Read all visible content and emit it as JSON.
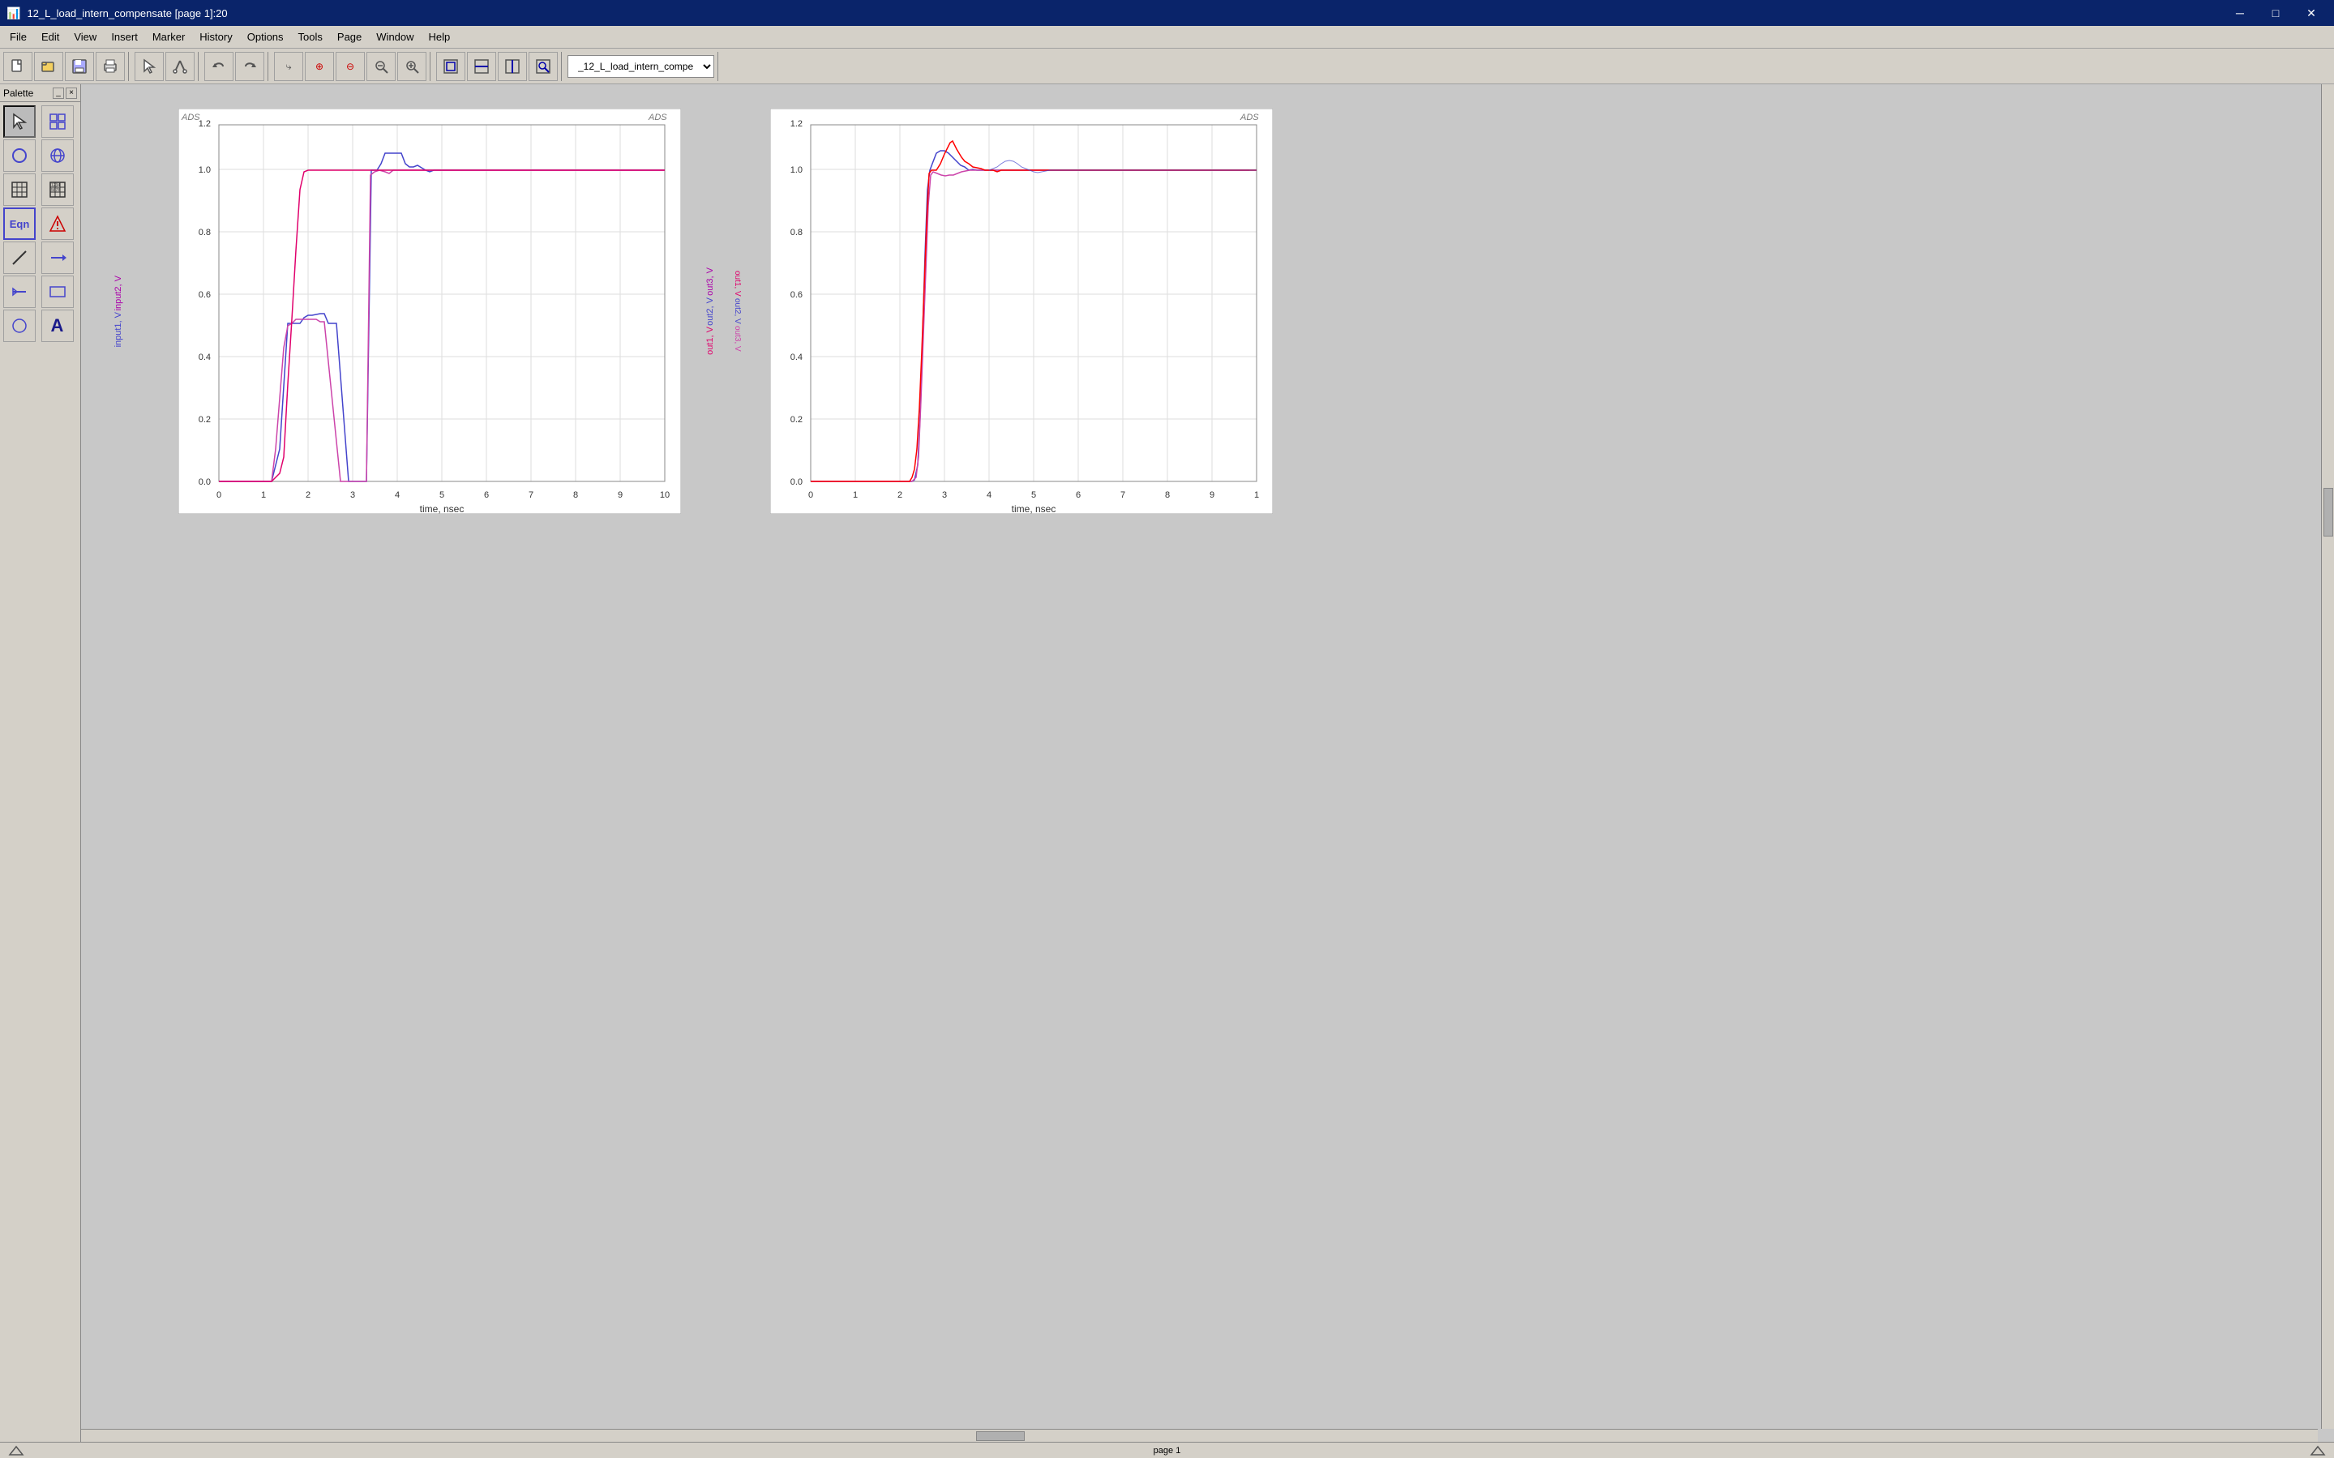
{
  "titleBar": {
    "title": "12_L_load_intern_compensate [page 1]:20",
    "minimize": "─",
    "maximize": "□",
    "close": "✕"
  },
  "menuBar": {
    "items": [
      "File",
      "Edit",
      "View",
      "Insert",
      "Marker",
      "History",
      "Options",
      "Tools",
      "Page",
      "Window",
      "Help"
    ]
  },
  "toolbar": {
    "dropdown": "_12_L_load_intern_compe ▾",
    "buttons": [
      "new",
      "open",
      "save",
      "print",
      "pointer",
      "cut",
      "undo",
      "redo",
      "probe",
      "add-marker",
      "zoom-in",
      "zoom-out",
      "zoom-fit",
      "zoom-area"
    ]
  },
  "palette": {
    "title": "Palette",
    "tools": [
      {
        "name": "pointer",
        "icon": "↖"
      },
      {
        "name": "grid",
        "icon": "⊞"
      },
      {
        "name": "circle-outline",
        "icon": "◯"
      },
      {
        "name": "globe",
        "icon": "🌐"
      },
      {
        "name": "table-small",
        "icon": "▦"
      },
      {
        "name": "number-label",
        "icon": "🔢"
      },
      {
        "name": "equation",
        "icon": "Eqn"
      },
      {
        "name": "triangle-warning",
        "icon": "⚠"
      },
      {
        "name": "line",
        "icon": "╱"
      },
      {
        "name": "arrow",
        "icon": "➤"
      },
      {
        "name": "arrow-left",
        "icon": "◁"
      },
      {
        "name": "rectangle",
        "icon": "▭"
      },
      {
        "name": "circle-filled",
        "icon": "●"
      },
      {
        "name": "text",
        "icon": "A"
      }
    ]
  },
  "plot1": {
    "adsLabel": "ADS",
    "yAxisLabels": [
      "1.2",
      "1.0",
      "0.8",
      "0.6",
      "0.4",
      "0.2",
      "0.0"
    ],
    "xAxisLabels": [
      "0",
      "1",
      "2",
      "3",
      "4",
      "5",
      "6",
      "7",
      "8",
      "9",
      "10"
    ],
    "xAxisTitle": "time, nsec",
    "yAxisTitle": "input2, V\ninput1, V",
    "legend": {
      "lines": [
        "out3, V",
        "out2, V",
        "out1, V"
      ]
    }
  },
  "plot2": {
    "adsLabel": "ADS",
    "yAxisLabels": [
      "1.2",
      "1.0",
      "0.8",
      "0.6",
      "0.4",
      "0.2",
      "0.0"
    ],
    "xAxisLabels": [
      "0",
      "1",
      "2",
      "3",
      "4",
      "5",
      "6",
      "7",
      "8",
      "9",
      "1"
    ],
    "xAxisTitle": "time, nsec",
    "yAxisTitle": "out3, V\nout2, V\nout1, V"
  },
  "statusBar": {
    "pageLabel": "page 1"
  },
  "colors": {
    "accent": "#0a246a",
    "background": "#d4d0c8",
    "plotBg": "white",
    "grid": "#dddddd",
    "line1": "#cc44aa",
    "line2": "#4444cc",
    "line3": "#e0006c",
    "line4": "#ff0000"
  }
}
